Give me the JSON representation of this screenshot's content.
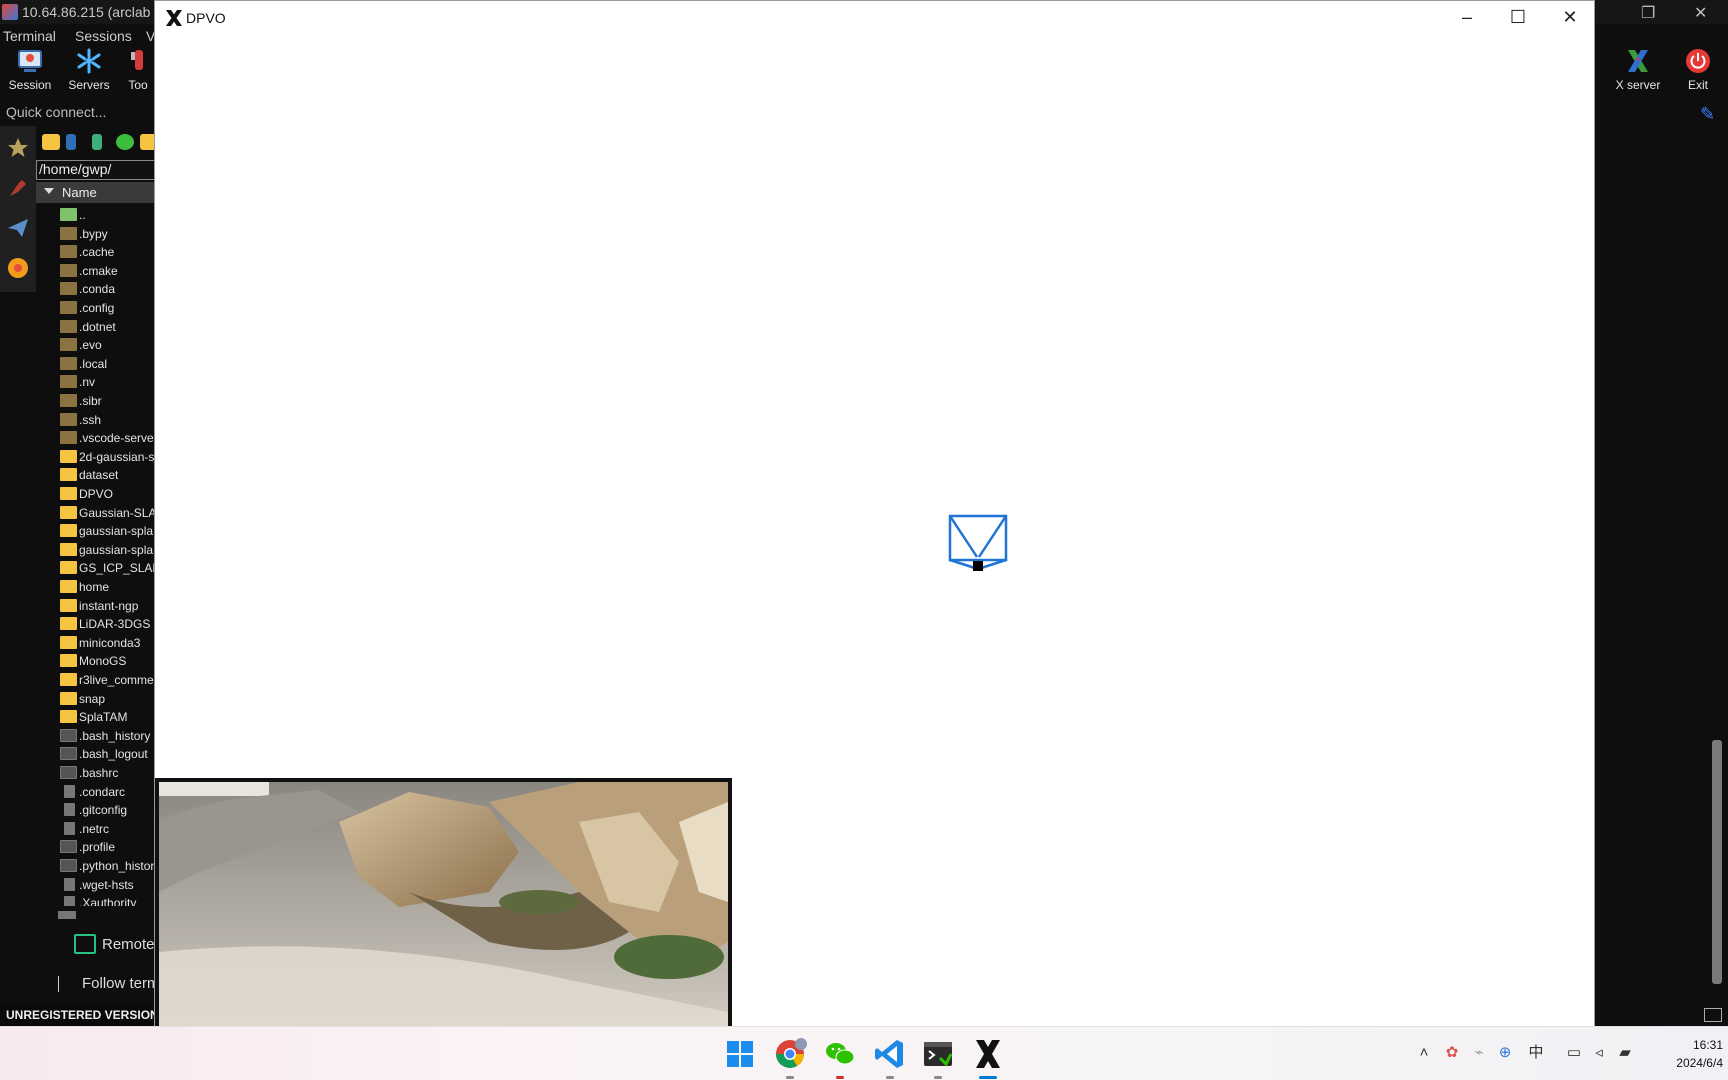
{
  "moba": {
    "title": "10.64.86.215  (arclab",
    "menu": [
      "Terminal",
      "Sessions",
      "Vi"
    ],
    "toolbar_left": [
      {
        "label": "Session",
        "icon": "session-icon"
      },
      {
        "label": "Servers",
        "icon": "servers-icon"
      },
      {
        "label": "Too",
        "icon": "tools-icon"
      }
    ],
    "toolbar_right": [
      {
        "label": "X server",
        "icon": "x-server-icon"
      },
      {
        "label": "Exit",
        "icon": "power-icon"
      }
    ],
    "quick_connect_placeholder": "Quick connect...",
    "path": "/home/gwp/",
    "column_name": "Name",
    "files": [
      {
        "name": "..",
        "kind": "up"
      },
      {
        "name": ".bypy",
        "kind": "dir-hidden"
      },
      {
        "name": ".cache",
        "kind": "dir-hidden"
      },
      {
        "name": ".cmake",
        "kind": "dir-hidden"
      },
      {
        "name": ".conda",
        "kind": "dir-hidden"
      },
      {
        "name": ".config",
        "kind": "dir-hidden"
      },
      {
        "name": ".dotnet",
        "kind": "dir-hidden"
      },
      {
        "name": ".evo",
        "kind": "dir-hidden"
      },
      {
        "name": ".local",
        "kind": "dir-hidden"
      },
      {
        "name": ".nv",
        "kind": "dir-hidden"
      },
      {
        "name": ".sibr",
        "kind": "dir-hidden"
      },
      {
        "name": ".ssh",
        "kind": "dir-hidden"
      },
      {
        "name": ".vscode-serve",
        "kind": "dir-hidden"
      },
      {
        "name": "2d-gaussian-s",
        "kind": "dir"
      },
      {
        "name": "dataset",
        "kind": "dir"
      },
      {
        "name": "DPVO",
        "kind": "dir"
      },
      {
        "name": "Gaussian-SLA",
        "kind": "dir"
      },
      {
        "name": "gaussian-spla",
        "kind": "dir"
      },
      {
        "name": "gaussian-spla",
        "kind": "dir"
      },
      {
        "name": "GS_ICP_SLAM",
        "kind": "dir"
      },
      {
        "name": "home",
        "kind": "dir"
      },
      {
        "name": "instant-ngp",
        "kind": "dir"
      },
      {
        "name": "LiDAR-3DGS",
        "kind": "dir"
      },
      {
        "name": "miniconda3",
        "kind": "dir"
      },
      {
        "name": "MonoGS",
        "kind": "dir"
      },
      {
        "name": "r3live_comme",
        "kind": "dir"
      },
      {
        "name": "snap",
        "kind": "dir"
      },
      {
        "name": "SplaTAM",
        "kind": "dir"
      },
      {
        "name": ".bash_history",
        "kind": "file-hidden"
      },
      {
        "name": ".bash_logout",
        "kind": "file-hidden"
      },
      {
        "name": ".bashrc",
        "kind": "file-hidden"
      },
      {
        "name": ".condarc",
        "kind": "doc"
      },
      {
        "name": ".gitconfig",
        "kind": "doc"
      },
      {
        "name": ".netrc",
        "kind": "doc"
      },
      {
        "name": ".profile",
        "kind": "file-hidden"
      },
      {
        "name": ".python_histor",
        "kind": "file-hidden"
      },
      {
        "name": ".wget-hsts",
        "kind": "doc"
      },
      {
        "name": ".Xauthority",
        "kind": "doc"
      }
    ],
    "remote_monitor_label": "Remote",
    "follow_terminal_label": "Follow term",
    "unregistered_label": "UNREGISTERED VERSION"
  },
  "dpvo": {
    "title": "DPVO",
    "frustum_color": "#1f74d6"
  },
  "taskbar": {
    "apps": [
      {
        "name": "start-button",
        "icon": "windows-logo-icon"
      },
      {
        "name": "chrome",
        "icon": "chrome-icon"
      },
      {
        "name": "wechat",
        "icon": "wechat-icon"
      },
      {
        "name": "vscode",
        "icon": "vscode-icon"
      },
      {
        "name": "mobaxterm",
        "icon": "terminal-icon"
      },
      {
        "name": "xserver",
        "icon": "x-server-icon"
      }
    ],
    "tray_ime": "中",
    "time": "16:31",
    "date": "2024/6/4"
  }
}
